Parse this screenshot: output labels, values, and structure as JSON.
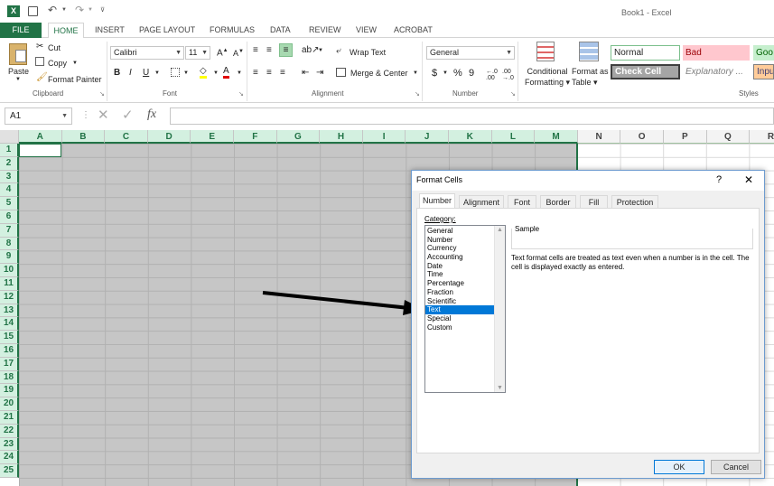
{
  "window": {
    "title": "Book1 - Excel"
  },
  "tabs": [
    {
      "label": "FILE"
    },
    {
      "label": "HOME"
    },
    {
      "label": "INSERT"
    },
    {
      "label": "PAGE LAYOUT"
    },
    {
      "label": "FORMULAS"
    },
    {
      "label": "DATA"
    },
    {
      "label": "REVIEW"
    },
    {
      "label": "VIEW"
    },
    {
      "label": "ACROBAT"
    }
  ],
  "ribbon": {
    "clipboard": {
      "paste": "Paste",
      "cut": "Cut",
      "copy": "Copy",
      "format_painter": "Format Painter",
      "group": "Clipboard"
    },
    "font": {
      "name": "Calibri",
      "size": "11",
      "group": "Font"
    },
    "alignment": {
      "wrap": "Wrap Text",
      "merge": "Merge & Center",
      "group": "Alignment"
    },
    "number": {
      "format": "General",
      "currency": "$",
      "percent": "%",
      "comma": "9",
      "group": "Number"
    },
    "styles": {
      "conditional1": "Conditional",
      "conditional2": "Formatting",
      "format_as1": "Format as",
      "format_as2": "Table",
      "normal": "Normal",
      "bad": "Bad",
      "good": "Goo",
      "check": "Check Cell",
      "explanatory": "Explanatory ...",
      "input": "Inpu",
      "group": "Styles"
    }
  },
  "formula": {
    "namebox": "A1",
    "fx": "fx"
  },
  "grid": {
    "columns": [
      "A",
      "B",
      "C",
      "D",
      "E",
      "F",
      "G",
      "H",
      "I",
      "J",
      "K",
      "L",
      "M",
      "N",
      "O",
      "P",
      "Q",
      "R"
    ],
    "rows": [
      "1",
      "2",
      "3",
      "4",
      "5",
      "6",
      "7",
      "8",
      "9",
      "10",
      "11",
      "12",
      "13",
      "14",
      "15",
      "16",
      "17",
      "18",
      "19",
      "20",
      "21",
      "22",
      "23",
      "24",
      "25"
    ]
  },
  "dialog": {
    "title": "Format Cells",
    "help": "?",
    "close": "✕",
    "tabs": [
      "Number",
      "Alignment",
      "Font",
      "Border",
      "Fill",
      "Protection"
    ],
    "category_label": "Category:",
    "categories": [
      "General",
      "Number",
      "Currency",
      "Accounting",
      "Date",
      "Time",
      "Percentage",
      "Fraction",
      "Scientific",
      "Text",
      "Special",
      "Custom"
    ],
    "selected_category": "Text",
    "sample_label": "Sample",
    "description": "Text format cells are treated as text even when a number is in the cell. The cell is displayed exactly as entered.",
    "ok": "OK",
    "cancel": "Cancel"
  },
  "colors": {
    "excel_green": "#217346",
    "selection_fill": "#c6c6c6",
    "list_highlight": "#0078d7"
  }
}
